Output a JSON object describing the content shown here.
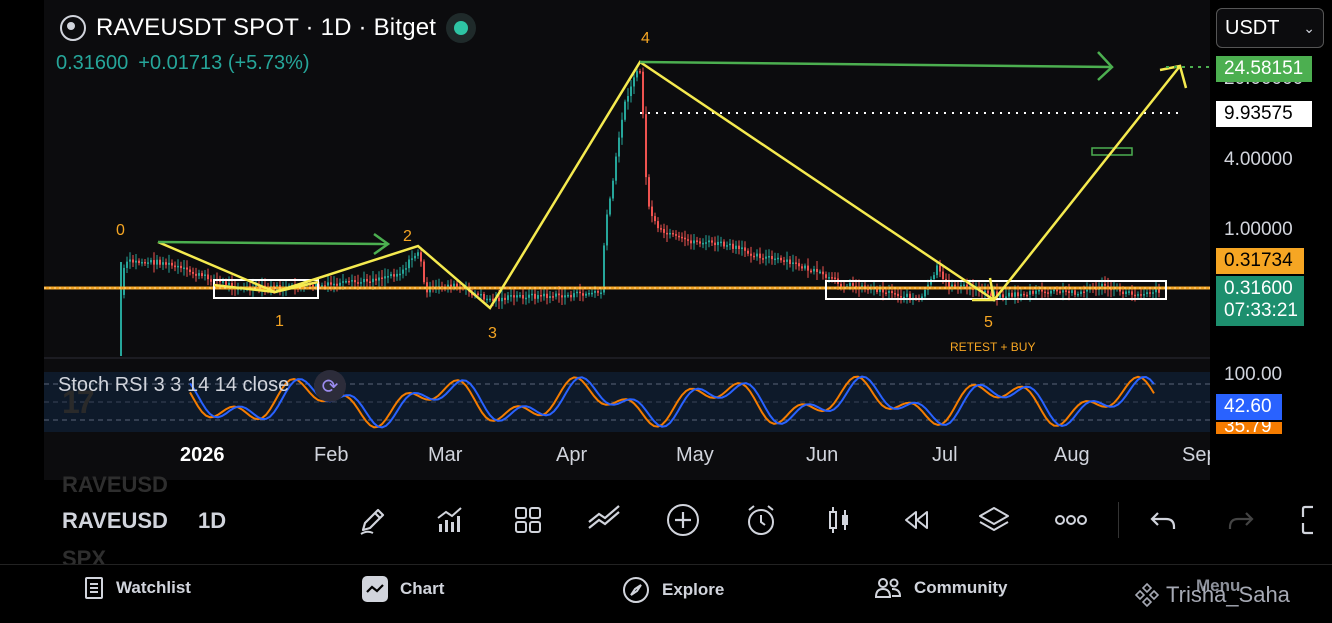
{
  "header": {
    "title": "RAVEUSDT SPOT · 1D · Bitget",
    "last_price": "0.31600",
    "change": "+0.01713 (+5.73%)",
    "currency_select": "USDT"
  },
  "price_axis": {
    "labels": [
      "24.58151",
      "9.93575",
      "4.00000",
      "1.00000",
      "0.31734",
      "0.31600",
      "07:33:21",
      "20.00000"
    ],
    "tag_green": "24.58151",
    "tag_white": "9.93575",
    "tag_orange": "0.31734",
    "tag_current": "0.31600",
    "countdown": "07:33:21",
    "tick_4": "4.00000",
    "tick_1": "1.00000"
  },
  "time_axis": [
    "2026",
    "Feb",
    "Mar",
    "Apr",
    "May",
    "Jun",
    "Jul",
    "Aug",
    "Sep"
  ],
  "wave_labels": [
    "0",
    "1",
    "2",
    "3",
    "4",
    "5"
  ],
  "annotation_text": "RETEST + BUY",
  "indicator": {
    "label": "Stoch RSI 3 3 14 14 close",
    "axis_top": "100.00",
    "value_blue": "42.60",
    "value_orange": "35.79"
  },
  "toolbar": {
    "symbol_ghost_top": "RAVEUSD",
    "symbol": "RAVEUSD",
    "symbol_ghost_bottom": "SPX",
    "interval": "1D",
    "icons": [
      "pen-icon",
      "indicators-icon",
      "layouts-icon",
      "compare-icon",
      "add-icon",
      "alert-icon",
      "candles-icon",
      "replay-icon",
      "layers-icon",
      "more-icon",
      "undo-icon",
      "redo-icon",
      "fullscreen-icon"
    ]
  },
  "nav": {
    "watchlist": "Watchlist",
    "chart": "Chart",
    "explore": "Explore",
    "community": "Community",
    "menu": "Menu"
  },
  "watermark": "Trisha_Saha",
  "colors": {
    "up": "#26a69a",
    "down": "#ef5350",
    "support": "#f6a623",
    "drawing_yellow": "#f5ea4f",
    "drawing_green": "#4caf50",
    "rsi_blue": "#2962ff",
    "rsi_orange": "#f57c00"
  }
}
